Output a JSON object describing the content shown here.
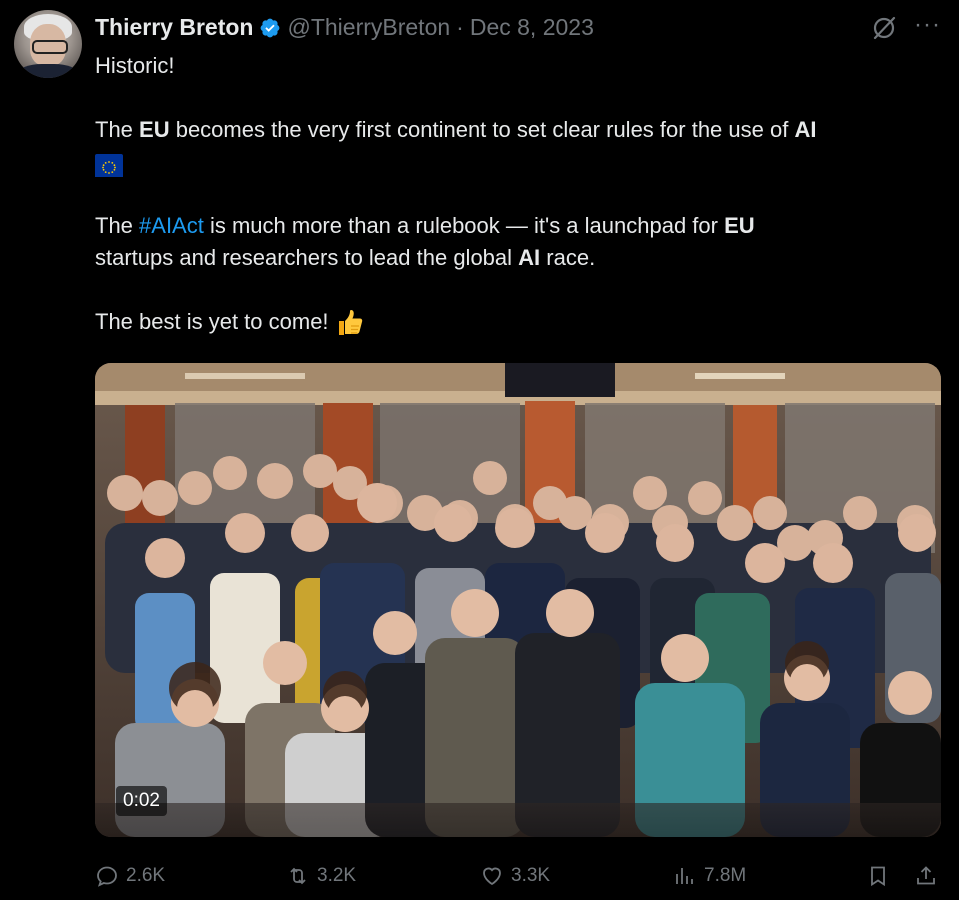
{
  "author": {
    "name": "Thierry Breton",
    "handle": "@ThierryBreton",
    "separator": "·",
    "date": "Dec 8, 2023",
    "avatar_icon": "avatar-photo",
    "verified_color": "#1d9bf0"
  },
  "post": {
    "line1": "Historic!",
    "p2": {
      "t1": "The ",
      "b1": "EU",
      "t2": " becomes the very first continent to set clear rules for the use of ",
      "b2": "AI"
    },
    "p3": {
      "t1": "The ",
      "hashtag": "#AIAct",
      "t2": " is much more than a rulebook — it's a launchpad for ",
      "b1": "EU",
      "t3": " startups and researchers to lead the global ",
      "b2": "AI",
      "t4": " race."
    },
    "p4": "The best is yet to come! ",
    "hashtag_color": "#1d9bf0"
  },
  "media": {
    "type": "video",
    "timestamp": "0:02",
    "description_icon": "group-photo"
  },
  "actions": {
    "replies": "2.6K",
    "reposts": "3.2K",
    "likes": "3.3K",
    "views": "7.8M"
  }
}
